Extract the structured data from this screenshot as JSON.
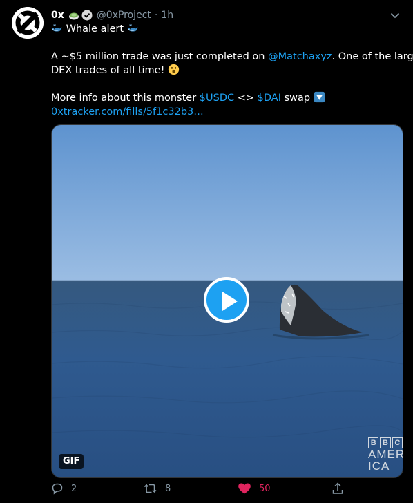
{
  "tweet": {
    "name": "0x",
    "handle": "@0xProject",
    "separator": "·",
    "time": "1h",
    "text": {
      "l1_pre": "Whale alert",
      "l2_a": "A ~$5 million trade was just completed on ",
      "l2_mention": "@Matchaxyz",
      "l2_b": ". One of the largest",
      "l3": "DEX trades of all time!",
      "l4_a": "More info about this monster ",
      "l4_usdc": "$USDC",
      "l4_mid": " <> ",
      "l4_dai": "$DAI",
      "l4_b": " swap",
      "l5_link": "0xtracker.com/fills/5f1c32b3…"
    },
    "media": {
      "badge": "GIF",
      "watermark_top": [
        "B",
        "B",
        "C"
      ],
      "watermark_l1": "AMER",
      "watermark_l2": "ICA"
    },
    "actions": {
      "replies": "2",
      "retweets": "8",
      "likes": "50"
    }
  },
  "colors": {
    "background": "#000000",
    "link": "#1da1f2",
    "muted": "#8899a6",
    "like": "#e0245e"
  },
  "icons": [
    "logo-0x-icon",
    "matcha-emoji-icon",
    "verified-icon",
    "chevron-down-icon",
    "whale-icon",
    "astonished-emoji-icon",
    "down-arrow-button-emoji-icon",
    "play-icon",
    "reply-icon",
    "retweet-icon",
    "like-icon",
    "share-icon"
  ]
}
